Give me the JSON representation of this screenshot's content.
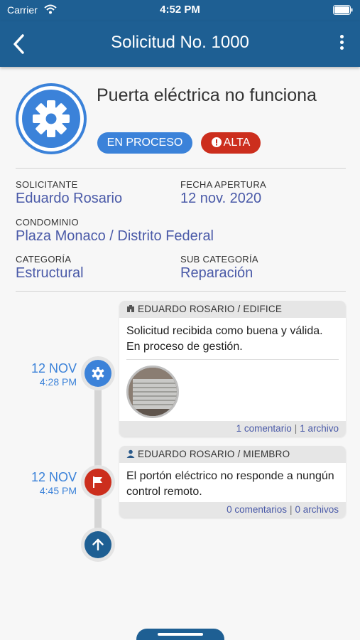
{
  "status_bar": {
    "carrier": "Carrier",
    "time": "4:52 PM"
  },
  "nav": {
    "title": "Solicitud No. 1000"
  },
  "request": {
    "title": "Puerta eléctrica no funciona",
    "status": "EN PROCESO",
    "priority": "ALTA",
    "colors": {
      "primary": "#1e5f93",
      "accent": "#3b82d9",
      "priority": "#cc2e1d",
      "value_text": "#4a5aa8"
    }
  },
  "fields": {
    "solicitante_label": "SOLICITANTE",
    "solicitante_value": "Eduardo Rosario",
    "fecha_label": "FECHA APERTURA",
    "fecha_value": "12 nov. 2020",
    "condominio_label": "CONDOMINIO",
    "condominio_value": "Plaza Monaco / Distrito Federal",
    "categoria_label": "CATEGORÍA",
    "categoria_value": "Estructural",
    "subcategoria_label": "SUB CATEGORÍA",
    "subcategoria_value": "Reparación"
  },
  "timeline": [
    {
      "day": "12 NOV",
      "time": "4:28 PM",
      "icon": "gear-icon",
      "author": "EDUARDO ROSARIO / EDIFICE",
      "author_icon": "building-icon",
      "message": "Solicitud recibida como buena y válida. En proceso de gestión.",
      "comments": "1 comentario",
      "files": "1 archivo"
    },
    {
      "day": "12 NOV",
      "time": "4:45 PM",
      "icon": "flag-icon",
      "author": "EDUARDO ROSARIO / MIEMBRO",
      "author_icon": "person-icon",
      "message": "El portón eléctrico no responde a nungún control remoto.",
      "comments": "0 comentarios",
      "files": "0 archivos"
    }
  ]
}
